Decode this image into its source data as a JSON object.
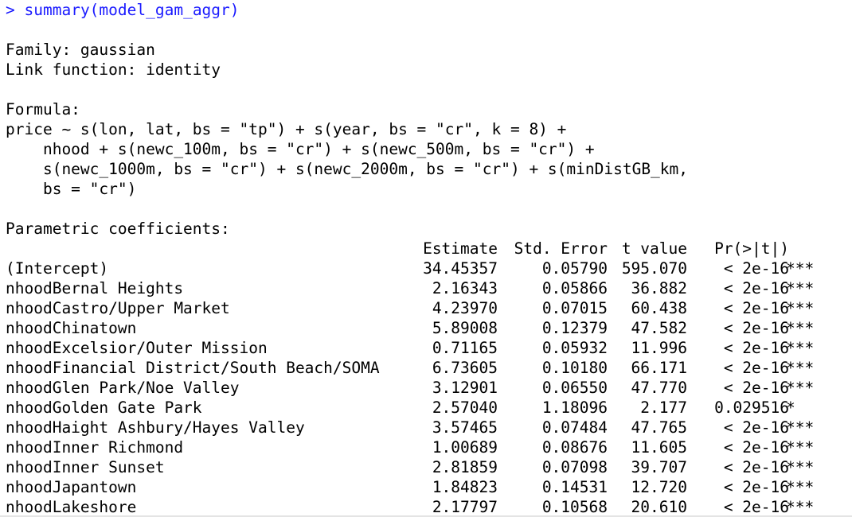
{
  "console": {
    "prompt": ">",
    "command": "summary(model_gam_aggr)",
    "family_line": "Family: gaussian",
    "link_line": "Link function: identity",
    "formula_header": "Formula:",
    "formula_lines": [
      "price ~ s(lon, lat, bs = \"tp\") + s(year, bs = \"cr\", k = 8) +",
      "    nhood + s(newc_100m, bs = \"cr\") + s(newc_500m, bs = \"cr\") +",
      "    s(newc_1000m, bs = \"cr\") + s(newc_2000m, bs = \"cr\") + s(minDistGB_km,",
      "    bs = \"cr\")"
    ],
    "coef_header": "Parametric coefficients:",
    "columns": {
      "estimate": "Estimate",
      "std_error": "Std. Error",
      "t_value": "t value",
      "p_value": "Pr(>|t|)"
    },
    "rows": [
      {
        "name": "(Intercept)",
        "estimate": "34.45357",
        "std_error": "0.05790",
        "t_value": "595.070",
        "p_value": "< 2e-16",
        "signif": "***"
      },
      {
        "name": "nhoodBernal Heights",
        "estimate": "2.16343",
        "std_error": "0.05866",
        "t_value": "36.882",
        "p_value": "< 2e-16",
        "signif": "***"
      },
      {
        "name": "nhoodCastro/Upper Market",
        "estimate": "4.23970",
        "std_error": "0.07015",
        "t_value": "60.438",
        "p_value": "< 2e-16",
        "signif": "***"
      },
      {
        "name": "nhoodChinatown",
        "estimate": "5.89008",
        "std_error": "0.12379",
        "t_value": "47.582",
        "p_value": "< 2e-16",
        "signif": "***"
      },
      {
        "name": "nhoodExcelsior/Outer Mission",
        "estimate": "0.71165",
        "std_error": "0.05932",
        "t_value": "11.996",
        "p_value": "< 2e-16",
        "signif": "***"
      },
      {
        "name": "nhoodFinancial District/South Beach/SOMA",
        "estimate": "6.73605",
        "std_error": "0.10180",
        "t_value": "66.171",
        "p_value": "< 2e-16",
        "signif": "***"
      },
      {
        "name": "nhoodGlen Park/Noe Valley",
        "estimate": "3.12901",
        "std_error": "0.06550",
        "t_value": "47.770",
        "p_value": "< 2e-16",
        "signif": "***"
      },
      {
        "name": "nhoodGolden Gate Park",
        "estimate": "2.57040",
        "std_error": "1.18096",
        "t_value": "2.177",
        "p_value": "0.029516",
        "signif": "*"
      },
      {
        "name": "nhoodHaight Ashbury/Hayes Valley",
        "estimate": "3.57465",
        "std_error": "0.07484",
        "t_value": "47.765",
        "p_value": "< 2e-16",
        "signif": "***"
      },
      {
        "name": "nhoodInner Richmond",
        "estimate": "1.00689",
        "std_error": "0.08676",
        "t_value": "11.605",
        "p_value": "< 2e-16",
        "signif": "***"
      },
      {
        "name": "nhoodInner Sunset",
        "estimate": "2.81859",
        "std_error": "0.07098",
        "t_value": "39.707",
        "p_value": "< 2e-16",
        "signif": "***"
      },
      {
        "name": "nhoodJapantown",
        "estimate": "1.84823",
        "std_error": "0.14531",
        "t_value": "12.720",
        "p_value": "< 2e-16",
        "signif": "***"
      },
      {
        "name": "nhoodLakeshore",
        "estimate": "2.17797",
        "std_error": "0.10568",
        "t_value": "20.610",
        "p_value": "< 2e-16",
        "signif": "***"
      }
    ]
  },
  "colors": {
    "command": "#1a1aff",
    "output": "#000000",
    "background": "#ffffff"
  }
}
